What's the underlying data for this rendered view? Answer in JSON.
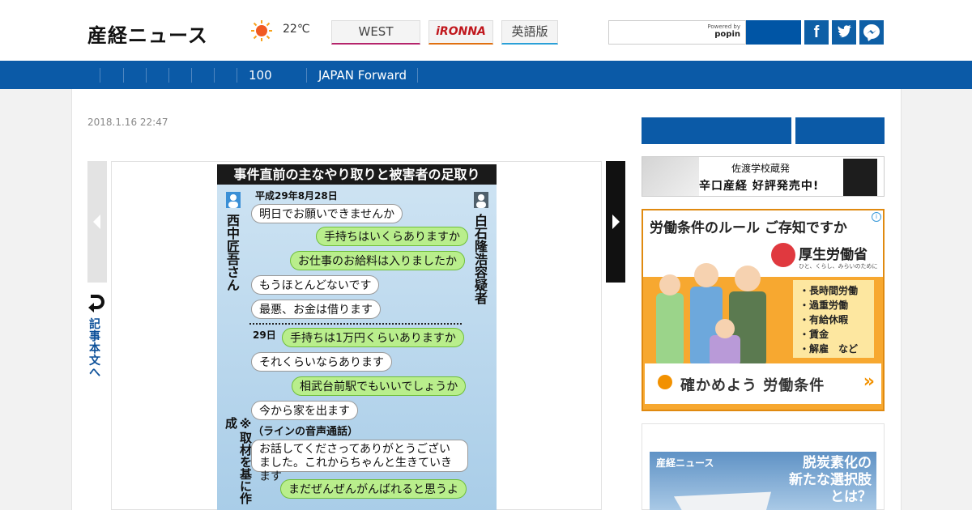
{
  "header": {
    "logo": "産経ニュース",
    "weather_icon": "sun-icon",
    "temperature": "22℃",
    "links": [
      "WEST",
      "iRONNA",
      "英語版"
    ],
    "search": {
      "placeholder": "",
      "powered_by": "Powered by",
      "powered_brand": "popin"
    },
    "social_icons": [
      "facebook-icon",
      "twitter-icon",
      "messenger-icon"
    ]
  },
  "nav": {
    "items": [
      "",
      "",
      "",
      "",
      "",
      "",
      "100",
      "JAPAN Forward"
    ]
  },
  "article": {
    "date": "2018.1.16 22:47",
    "back_to_article": "記事本文へ"
  },
  "figure": {
    "title": "事件直前の主なやり取りと被害者の足取り",
    "date1": "平成29年8月28日",
    "date2": "29日",
    "left_person": "西中匠吾さん",
    "right_person": "白石隆浩容疑者",
    "messages": [
      "明日でお願いできませんか",
      "手持ちはいくらありますか",
      "お仕事のお給料は入りましたか",
      "もうほとんどないです",
      "最悪、お金は借ります",
      "手持ちは1万円くらいありますか",
      "それくらいならあります",
      "相武台前駅でもいいでしょうか",
      "今から家を出ます",
      "お話してくださってありがとうございました。これからちゃんと生きていきます",
      "まだぜんぜんがんばれると思うよ"
    ],
    "voice_call": "（ラインの音声通話）",
    "note": "※取材を基に作成"
  },
  "sidebar": {
    "ad1": {
      "line1": "佐渡学校蔵発",
      "line2": "辛口産経 好評発売中!"
    },
    "ad2": {
      "headline": "労働条件のルール ご存知ですか",
      "ministry": "厚生労働省",
      "ministry_sub": "ひと、くらし、みらいのために",
      "items": [
        "・長時間労働",
        "・過重労働",
        "・有給休暇",
        "・賃金",
        "・解雇　など"
      ],
      "cta": "確かめよう 労働条件"
    },
    "ad3": {
      "brand": "産経ニュース",
      "copy_lines": [
        "脱炭素化の",
        "新たな選択肢",
        "とは？"
      ]
    }
  },
  "colors": {
    "brand_blue": "#0b5aa7",
    "line_green": "#b9ee8c",
    "ad_orange": "#f7a830"
  }
}
